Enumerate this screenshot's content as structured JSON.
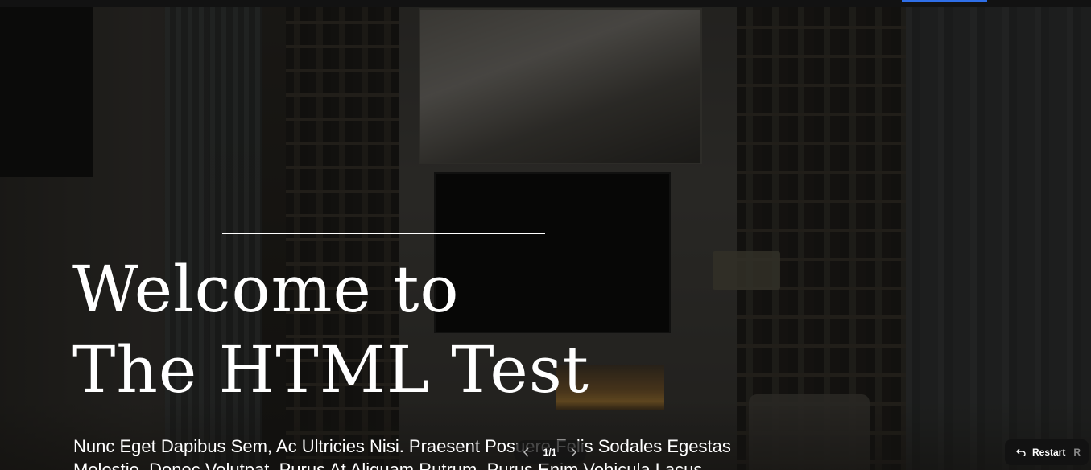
{
  "hero": {
    "title_line1": "Welcome to",
    "title_line2": "The HTML Test",
    "subtitle": "Nunc Eget Dapibus Sem, Ac Ultricies Nisi. Praesent Posuere Felis Sodales Egestas Molestie. Donec Volutpat, Purus At Aliquam Rutrum, Purus Enim Vehicula Lacus"
  },
  "pager": {
    "label": "1/1",
    "prev_icon": "chevron-left-icon",
    "next_icon": "chevron-right-icon"
  },
  "restart": {
    "label": "Restart",
    "shortcut": "R",
    "icon": "undo-arrow-icon"
  },
  "colors": {
    "accent": "#2f6fe8",
    "text": "#ffffff",
    "overlay": "#0a0908"
  }
}
